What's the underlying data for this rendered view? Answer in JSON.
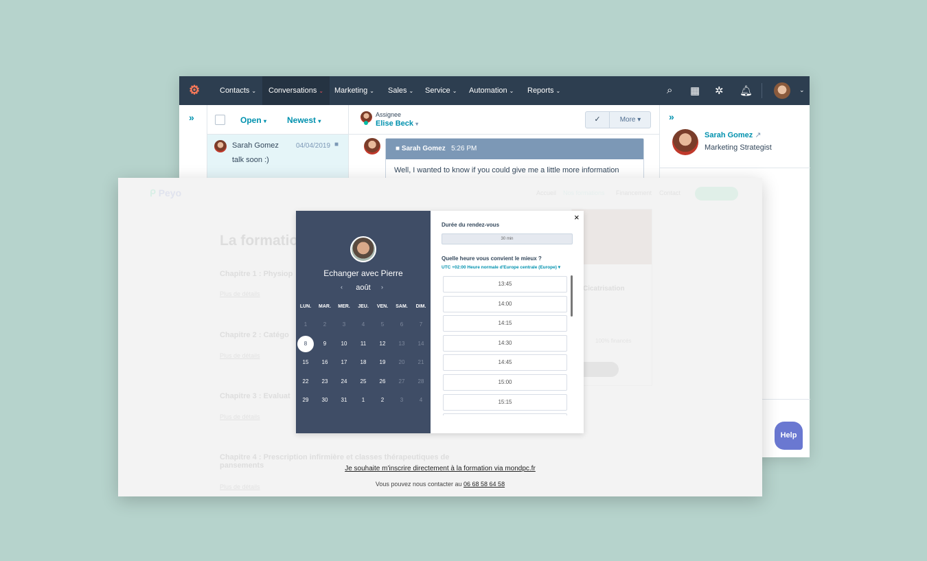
{
  "hubspot": {
    "nav": [
      {
        "label": "Contacts"
      },
      {
        "label": "Conversations"
      },
      {
        "label": "Marketing"
      },
      {
        "label": "Sales"
      },
      {
        "label": "Service"
      },
      {
        "label": "Automation"
      },
      {
        "label": "Reports"
      }
    ],
    "nav_icons": [
      "search-icon",
      "marketplace-icon",
      "gear-icon",
      "bell-icon"
    ],
    "list": {
      "filter_status": "Open",
      "filter_sort": "Newest",
      "items": [
        {
          "name": "Sarah Gomez",
          "date": "04/04/2019",
          "preview": "talk soon :)"
        }
      ]
    },
    "conversation": {
      "assignee_label": "Assignee",
      "assignee": "Elise Beck",
      "more_label": "More",
      "message": {
        "sender": "Sarah Gomez",
        "time": "5:26 PM",
        "text": "Well, I wanted to know if you could give me a little more information"
      }
    },
    "contact": {
      "name": "Sarah Gomez",
      "title": "Marketing Strategist"
    },
    "help_label": "Help",
    "colors": {
      "nav": "#2d3e50",
      "accent": "#0091ae",
      "help": "#6a78d1",
      "logo": "#ff7a59"
    }
  },
  "website": {
    "logo": "Peyo",
    "nav": [
      "Accueil",
      "Nos formations",
      "Financement",
      "Contact"
    ],
    "heading": "La formatio",
    "chapters": [
      {
        "title": "Chapitre 1 : Physiop",
        "more": "Plus de détails"
      },
      {
        "title": "Chapitre 2 : Catégo",
        "more": "Plus de détails"
      },
      {
        "title": "Chapitre 3 : Evaluat",
        "more": "Plus de détails"
      },
      {
        "title": "Chapitre 4 : Prescription infirmière et classes thérapeutiques de pansements",
        "more": "Plus de détails"
      }
    ],
    "card": {
      "title": "Cicatrisation",
      "funding": "100% financés"
    },
    "register_link": "Je souhaite m'inscrire directement à la formation via mondpc.fr",
    "contact_text": "Vous pouvez nous contacter au",
    "phone": "06 68 58 64 58"
  },
  "booking": {
    "title": "Echanger avec Pierre",
    "month": "août",
    "weekdays": [
      "LUN.",
      "MAR.",
      "MER.",
      "JEU.",
      "VEN.",
      "SAM.",
      "DIM."
    ],
    "weeks": [
      [
        "1",
        "2",
        "3",
        "4",
        "5",
        "6",
        "7"
      ],
      [
        "8",
        "9",
        "10",
        "11",
        "12",
        "13",
        "14"
      ],
      [
        "15",
        "16",
        "17",
        "18",
        "19",
        "20",
        "21"
      ],
      [
        "22",
        "23",
        "24",
        "25",
        "26",
        "27",
        "28"
      ],
      [
        "29",
        "30",
        "31",
        "1",
        "2",
        "3",
        "4"
      ]
    ],
    "selected_day": "8",
    "duration_label": "Durée du rendez-vous",
    "duration": "30 min",
    "time_question": "Quelle heure vous convient le mieux ?",
    "timezone": "UTC +02:00 Heure normale d'Europe centrale (Europe)",
    "slots": [
      "13:45",
      "14:00",
      "14:15",
      "14:30",
      "14:45",
      "15:00",
      "15:15"
    ],
    "close": "×",
    "colors": {
      "panel": "#3f4d66",
      "accent": "#0091ae"
    }
  }
}
